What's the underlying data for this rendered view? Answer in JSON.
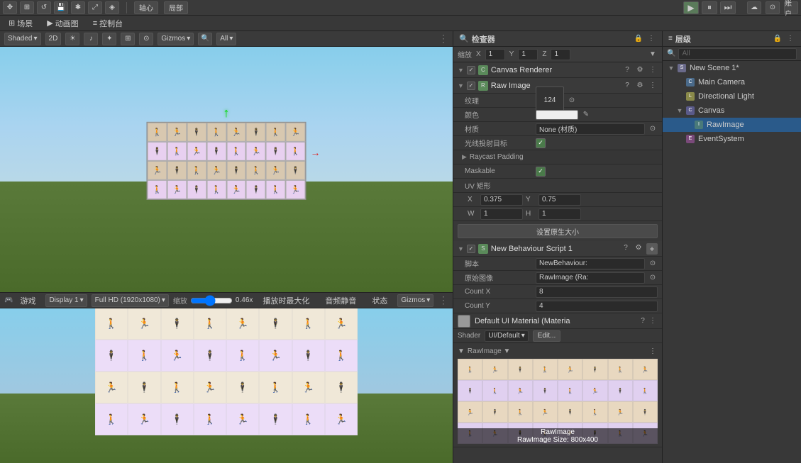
{
  "app": {
    "top_toolbar": {
      "tools": [
        "✥",
        "⊞",
        "↺",
        "💾",
        "✱",
        "⤢",
        "◈",
        "⟲",
        "⟳",
        "✂"
      ],
      "axis_label": "轴心",
      "local_label": "局部",
      "play_btn": "▶",
      "pause_btn": "⏸",
      "step_btn": "⏭",
      "account": "账户",
      "cloud": "☁"
    },
    "second_toolbar": {
      "scene_tab": "场景",
      "animation_tab": "动画图",
      "control_tab": "控制台"
    }
  },
  "scene_view": {
    "mode": "Shaded",
    "mode_2d": "2D",
    "gizmos": "Gizmos",
    "search_all": "All"
  },
  "game_view": {
    "tab": "游戏",
    "display": "Display 1",
    "resolution": "Full HD (1920x1080)",
    "scale_label": "缩放",
    "scale_value": "0.46x",
    "play_max": "播放时最大化",
    "audio_mute": "音频静音",
    "state": "状态",
    "gizmos": "Gizmos"
  },
  "inspector": {
    "title": "检查器",
    "position_label": "缩放",
    "x_label": "X",
    "x_val": "1",
    "y_label": "Y",
    "y_val": "1",
    "z_label": "Z",
    "z_val": "1",
    "components": {
      "canvas_renderer": {
        "name": "Canvas Renderer",
        "help": "?",
        "settings": "⚙",
        "more": "⋮"
      },
      "raw_image": {
        "name": "Raw Image",
        "texture_label": "纹理",
        "texture_val": "124",
        "color_label": "颜色",
        "material_label": "材质",
        "material_val": "None (材质)",
        "raycast_label": "光线投射目标",
        "maskable_label": "Maskable",
        "raycast_padding_label": "Raycast Padding",
        "uv_label": "UV 矩形",
        "uv_x": "0.375",
        "uv_y": "0.75",
        "uv_w": "W 1",
        "uv_h": "H 1",
        "set_native_btn": "设置原生大小"
      },
      "new_behaviour": {
        "name": "New Behaviour Script 1",
        "script_label": "脚本",
        "script_val": "NewBehaviour:",
        "raw_image_label": "原始图像",
        "raw_image_val": "RawImage (Ra:",
        "count_x_label": "Count X",
        "count_x_val": "8",
        "count_y_label": "Count Y",
        "count_y_val": "4"
      }
    },
    "material": {
      "name": "Default UI Material (Materia",
      "shader_label": "Shader",
      "shader_val": "UI/Default",
      "edit_btn": "Edit..."
    },
    "rawimage_preview": {
      "label": "RawImage ▼",
      "overlay_line1": "RawImage",
      "overlay_line2": "RawImage Size: 800x400"
    }
  },
  "hierarchy": {
    "title": "层级",
    "search_placeholder": "All",
    "items": [
      {
        "id": "new-scene",
        "label": "New Scene 1*",
        "indent": 0,
        "expanded": true,
        "icon": "scene"
      },
      {
        "id": "main-camera",
        "label": "Main Camera",
        "indent": 1,
        "icon": "camera"
      },
      {
        "id": "dir-light",
        "label": "Directional Light",
        "indent": 1,
        "icon": "light"
      },
      {
        "id": "canvas",
        "label": "Canvas",
        "indent": 1,
        "expanded": true,
        "icon": "canvas"
      },
      {
        "id": "rawimage",
        "label": "RawImage",
        "indent": 2,
        "icon": "image"
      },
      {
        "id": "eventsystem",
        "label": "EventSystem",
        "indent": 1,
        "icon": "event"
      }
    ]
  }
}
